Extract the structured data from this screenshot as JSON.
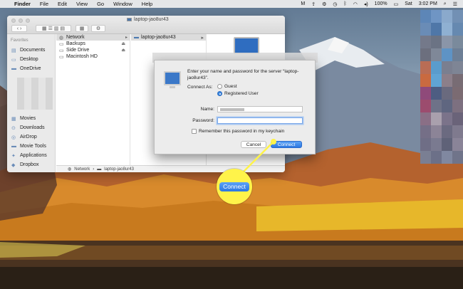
{
  "menubar": {
    "app": "Finder",
    "items": [
      "File",
      "Edit",
      "View",
      "Go",
      "Window",
      "Help"
    ],
    "status": {
      "battery": "100%",
      "day": "Sat",
      "time": "3:02 PM"
    }
  },
  "finder": {
    "title": "laptop-jao8ur43",
    "sidebar_heading": "Favorites",
    "sidebar_items": [
      {
        "label": "Documents",
        "icon": "document-icon"
      },
      {
        "label": "Desktop",
        "icon": "desktop-icon"
      },
      {
        "label": "OneDrive",
        "icon": "folder-icon"
      },
      {
        "label": "Movies",
        "icon": "film-icon"
      },
      {
        "label": "Downloads",
        "icon": "download-icon"
      },
      {
        "label": "AirDrop",
        "icon": "airdrop-icon"
      },
      {
        "label": "Movie Tools",
        "icon": "folder-icon"
      },
      {
        "label": "Applications",
        "icon": "applications-icon"
      },
      {
        "label": "Dropbox",
        "icon": "dropbox-icon"
      }
    ],
    "column1": [
      {
        "label": "Network",
        "icon": "globe-icon",
        "eject": false,
        "selected": true
      },
      {
        "label": "Backups",
        "icon": "drive-icon",
        "eject": true,
        "selected": false
      },
      {
        "label": "Side Drive",
        "icon": "drive-icon",
        "eject": true,
        "selected": false
      },
      {
        "label": "Macintosh HD",
        "icon": "drive-icon",
        "eject": false,
        "selected": false
      }
    ],
    "column2": [
      {
        "label": "laptop-jao8ur43",
        "icon": "server-icon"
      }
    ],
    "path": [
      "Network",
      "laptop-jao8ur43"
    ]
  },
  "dialog": {
    "prompt": "Enter your name and password for the server “laptop-jao8ur43”.",
    "connect_as_label": "Connect As:",
    "options": [
      "Guest",
      "Registered User"
    ],
    "selected_option": "Registered User",
    "name_label": "Name:",
    "name_value": "",
    "password_label": "Password:",
    "password_value": "",
    "remember_label": "Remember this password in my keychain",
    "remember_checked": false,
    "cancel_label": "Cancel",
    "connect_label": "Connect"
  },
  "callout": {
    "label": "Connect",
    "color": "#fff34a"
  },
  "colors": {
    "accent": "#2c77e0"
  }
}
